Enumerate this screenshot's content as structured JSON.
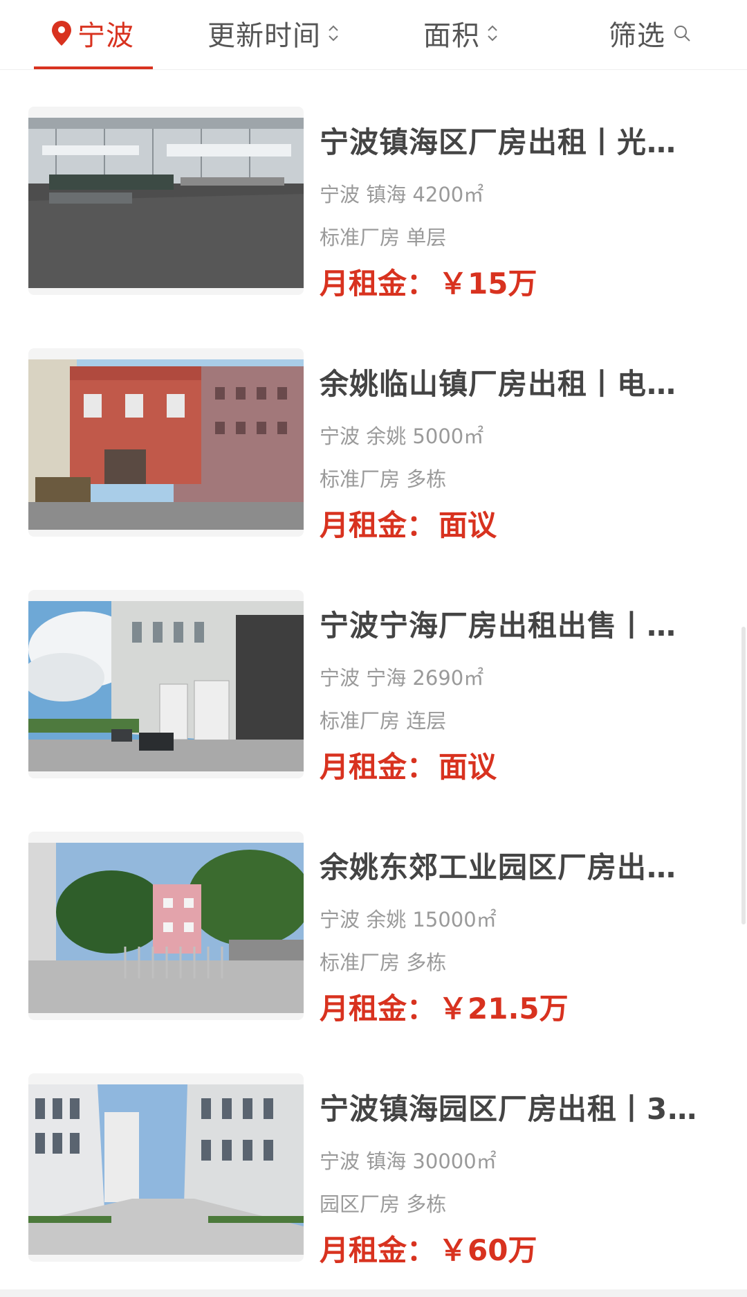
{
  "tabs": {
    "location": "宁波",
    "update_time": "更新时间",
    "area": "面积",
    "filter": "筛选"
  },
  "accent_color": "#d8321f",
  "listings": [
    {
      "title": "宁波镇海区厂房出租丨光…",
      "meta1": "宁波 镇海 4200㎡",
      "meta2": "标准厂房 单层",
      "price_label": "月租金：",
      "price_value": "￥15万",
      "image": "warehouse-interior"
    },
    {
      "title": "余姚临山镇厂房出租丨电…",
      "meta1": "宁波 余姚 5000㎡",
      "meta2": "标准厂房 多栋",
      "price_label": "月租金：",
      "price_value": "面议",
      "image": "red-brick-building"
    },
    {
      "title": "宁波宁海厂房出租出售丨…",
      "meta1": "宁波 宁海 2690㎡",
      "meta2": "标准厂房 连层",
      "price_label": "月租金：",
      "price_value": "面议",
      "image": "factory-street-sky"
    },
    {
      "title": "余姚东郊工业园区厂房出…",
      "meta1": "宁波 余姚 15000㎡",
      "meta2": "标准厂房 多栋",
      "price_label": "月租金：",
      "price_value": "￥21.5万",
      "image": "gate-pink-building"
    },
    {
      "title": "宁波镇海园区厂房出租丨3…",
      "meta1": "宁波 镇海 30000㎡",
      "meta2": "园区厂房 多栋",
      "price_label": "月租金：",
      "price_value": "￥60万",
      "image": "industrial-park-road"
    }
  ]
}
